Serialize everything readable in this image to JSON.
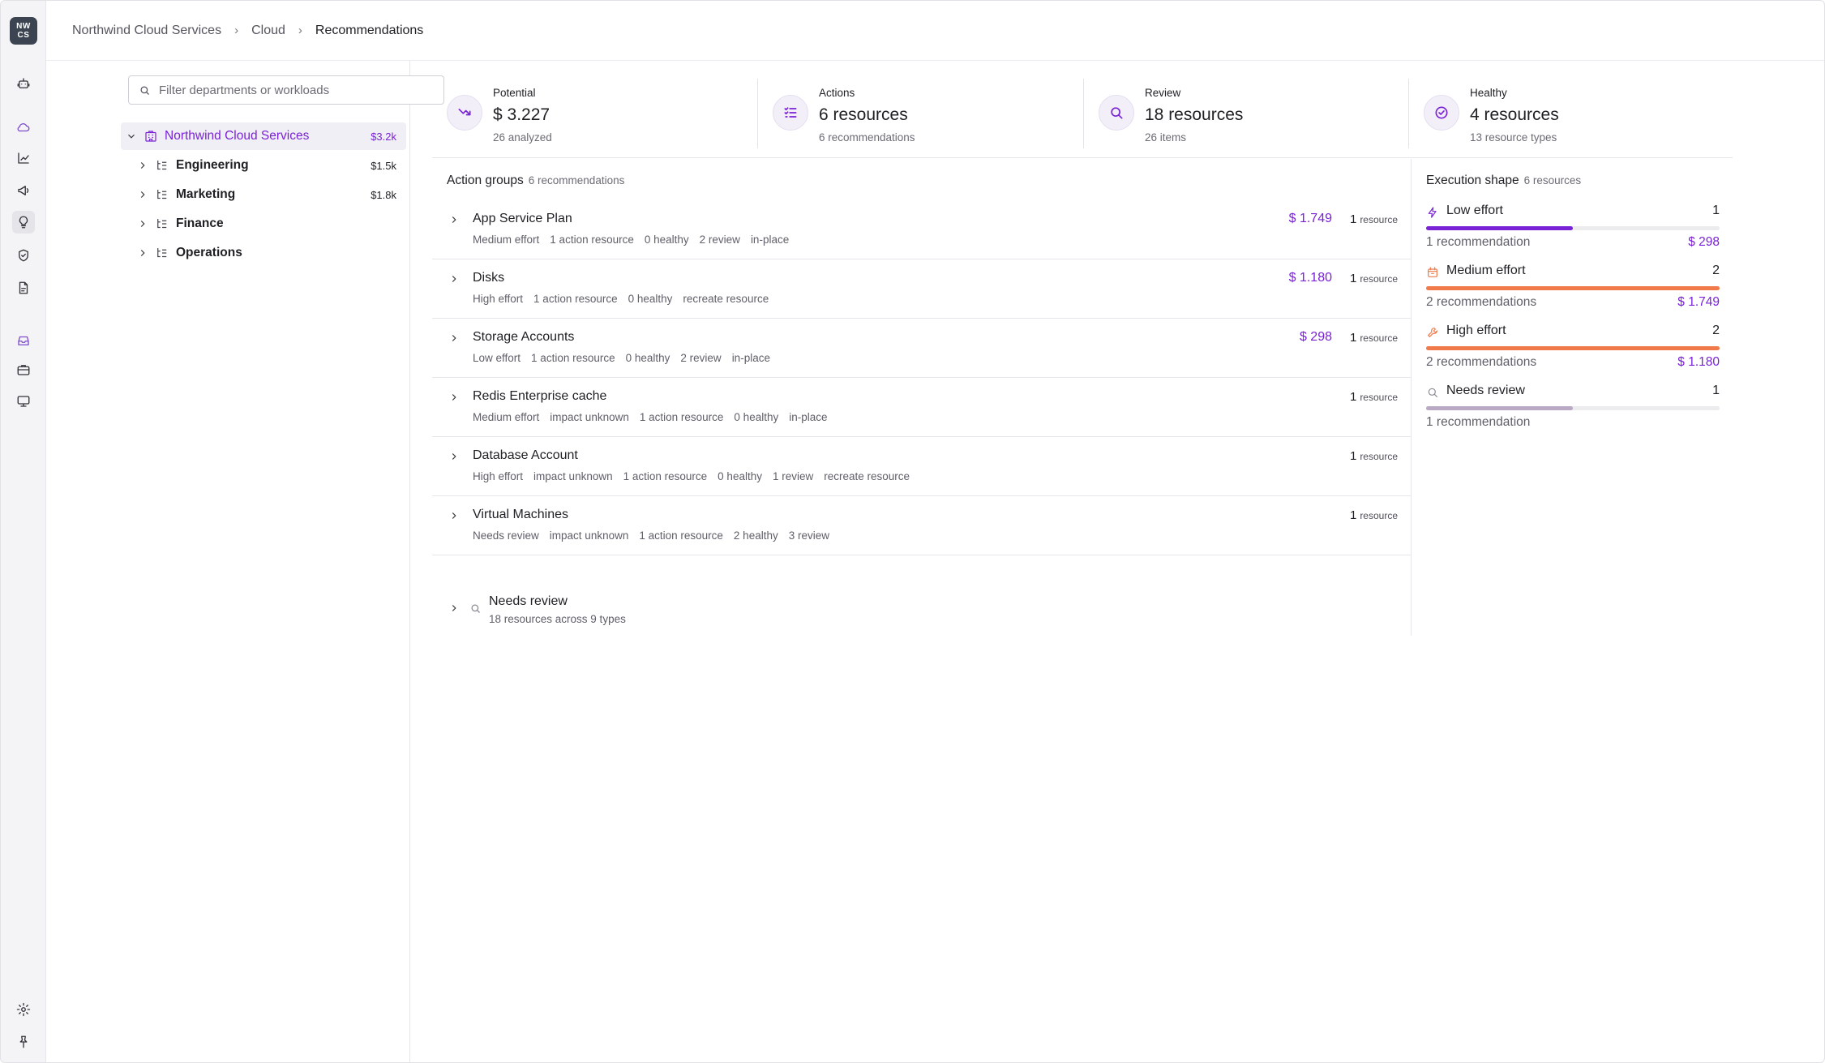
{
  "app": {
    "logo_text_line1": "NW",
    "logo_text_line2": "CS"
  },
  "breadcrumb": [
    "Northwind Cloud Services",
    "Cloud",
    "Recommendations"
  ],
  "rail": {
    "icons": [
      "robot-icon",
      "cloud-icon",
      "chart-icon",
      "megaphone-icon",
      "lightbulb-icon",
      "shield-icon",
      "file-icon",
      "inbox-icon",
      "briefcase-icon",
      "monitor-icon",
      "settings-icon",
      "pin-icon"
    ]
  },
  "search": {
    "placeholder": "Filter departments or workloads",
    "value": ""
  },
  "tree": [
    {
      "name": "Northwind Cloud Services",
      "amount": "$3.2k",
      "expanded": true,
      "selected": true
    },
    {
      "name": "Engineering",
      "amount": "$1.5k"
    },
    {
      "name": "Marketing",
      "amount": "$1.8k"
    },
    {
      "name": "Finance",
      "amount": ""
    },
    {
      "name": "Operations",
      "amount": ""
    }
  ],
  "kpis": [
    {
      "label": "Potential",
      "value": "$ 3.227",
      "sub": "26 analyzed",
      "icon": "trend-down-icon"
    },
    {
      "label": "Actions",
      "value": "6 resources",
      "sub": "6 recommendations",
      "icon": "checklist-icon"
    },
    {
      "label": "Review",
      "value": "18 resources",
      "sub": "26 items",
      "icon": "search-icon"
    },
    {
      "label": "Healthy",
      "value": "4 resources",
      "sub": "13 resource types",
      "icon": "check-circle-icon"
    }
  ],
  "action_groups": {
    "title": "Action groups",
    "subtitle": "6 recommendations",
    "resource_word": "resource",
    "items": [
      {
        "name": "App Service Plan",
        "savings": "$ 1.749",
        "resources": "1",
        "meta": [
          "Medium effort",
          "1 action resource",
          "0 healthy",
          "2 review",
          "in-place"
        ]
      },
      {
        "name": "Disks",
        "savings": "$ 1.180",
        "resources": "1",
        "meta": [
          "High effort",
          "1 action resource",
          "0 healthy",
          "recreate resource"
        ]
      },
      {
        "name": "Storage Accounts",
        "savings": "$ 298",
        "resources": "1",
        "meta": [
          "Low effort",
          "1 action resource",
          "0 healthy",
          "2 review",
          "in-place"
        ]
      },
      {
        "name": "Redis Enterprise cache",
        "savings": "",
        "resources": "1",
        "meta": [
          "Medium effort",
          "impact unknown",
          "1 action resource",
          "0 healthy",
          "in-place"
        ]
      },
      {
        "name": "Database Account",
        "savings": "",
        "resources": "1",
        "meta": [
          "High effort",
          "impact unknown",
          "1 action resource",
          "0 healthy",
          "1 review",
          "recreate resource"
        ]
      },
      {
        "name": "Virtual Machines",
        "savings": "",
        "resources": "1",
        "meta": [
          "Needs review",
          "impact unknown",
          "1 action resource",
          "2 healthy",
          "3 review"
        ]
      }
    ],
    "needs_review": {
      "title": "Needs review",
      "sub": "18 resources across 9 types"
    }
  },
  "execution_shape": {
    "title": "Execution shape",
    "subtitle": "6 resources",
    "items": [
      {
        "label": "Low effort",
        "count": "1",
        "recs": "1 recommendation",
        "savings": "$ 298",
        "fraction": 0.5,
        "color": "#7a22d6",
        "icon": "lightning-icon"
      },
      {
        "label": "Medium effort",
        "count": "2",
        "recs": "2 recommendations",
        "savings": "$ 1.749",
        "fraction": 1.0,
        "color": "#f07a4a",
        "icon": "calendar-icon"
      },
      {
        "label": "High effort",
        "count": "2",
        "recs": "2 recommendations",
        "savings": "$ 1.180",
        "fraction": 1.0,
        "color": "#f07a4a",
        "icon": "wrench-icon"
      },
      {
        "label": "Needs review",
        "count": "1",
        "recs": "1 recommendation",
        "savings": "",
        "fraction": 0.5,
        "color": "#b9a9c4",
        "icon": "search-icon"
      }
    ]
  },
  "colors": {
    "accent": "#7a22d6",
    "effort_orange": "#f07a4a"
  }
}
